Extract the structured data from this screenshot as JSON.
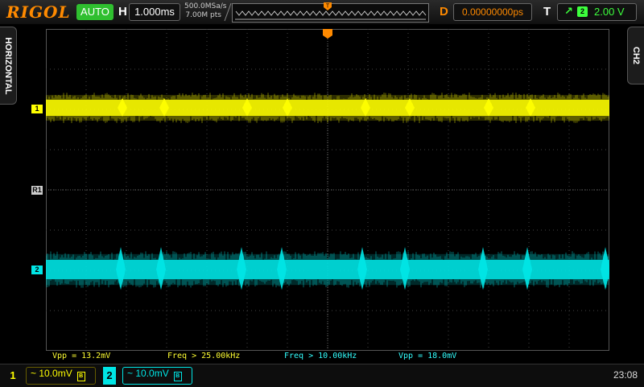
{
  "top": {
    "brand": "RIGOL",
    "run_status": "AUTO",
    "h_label": "H",
    "timebase": "1.000ms",
    "sample_rate": "500.0MSa/s",
    "memory_depth": "7.00M pts",
    "trigger_pos_icon": "T-marker-icon",
    "d_label": "D",
    "delay": "0.00000000ps",
    "t_label": "T",
    "trigger_edge": "rising-edge-icon",
    "trigger_source": "2",
    "trigger_level": "2.00 V"
  },
  "left_tab": "HORIZONTAL",
  "right_tab": "CH2",
  "markers": {
    "ch1": "1",
    "ref": "R1",
    "ch2": "2"
  },
  "measurements": [
    {
      "text": "Vpp = 13.2mV",
      "color": "#ffff33"
    },
    {
      "text": "Freq > 25.00kHz",
      "color": "#ffff33"
    },
    {
      "text": "Freq > 10.00kHz",
      "color": "#33ffff"
    },
    {
      "text": "Vpp = 18.0mV",
      "color": "#33ffff"
    }
  ],
  "bottom": {
    "ch1_num": "1",
    "ch1_value": "~ 10.0mV",
    "ch2_num": "2",
    "ch2_value": "~ 10.0mV",
    "time": "23:08"
  },
  "colors": {
    "ch1": "#ffff00",
    "ch2": "#00e5e5",
    "accent": "#ff8a00",
    "trigger": "#3dff3d"
  }
}
